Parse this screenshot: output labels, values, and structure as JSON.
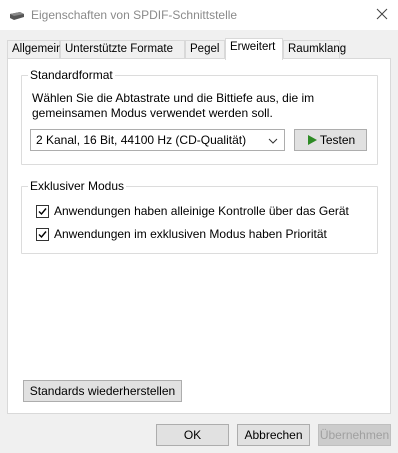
{
  "window": {
    "title": "Eigenschaften von SPDIF-Schnittstelle",
    "icon": "speaker-device-icon",
    "close_icon": "close-icon"
  },
  "tabs": [
    {
      "label": "Allgemein",
      "active": false
    },
    {
      "label": "Unterstützte Formate",
      "active": false
    },
    {
      "label": "Pegel",
      "active": false
    },
    {
      "label": "Erweitert",
      "active": true
    },
    {
      "label": "Raumklang",
      "active": false
    }
  ],
  "standardformat": {
    "title": "Standardformat",
    "description": "Wählen Sie die Abtastrate und die Bittiefe aus, die im gemeinsamen Modus verwendet werden soll.",
    "selected_format": "2 Kanal, 16 Bit, 44100 Hz (CD-Qualität)",
    "test_label": "Testen",
    "test_icon": "play-icon",
    "test_icon_color": "#2e8b25"
  },
  "exclusive": {
    "title": "Exklusiver Modus",
    "options": [
      {
        "label": "Anwendungen haben alleinige Kontrolle über das Gerät",
        "checked": true
      },
      {
        "label": "Anwendungen im exklusiven Modus haben Priorität",
        "checked": true
      }
    ]
  },
  "restore_label": "Standards wiederherstellen",
  "footer": {
    "ok_label": "OK",
    "cancel_label": "Abbrechen",
    "apply_label": "Übernehmen",
    "apply_enabled": false
  }
}
